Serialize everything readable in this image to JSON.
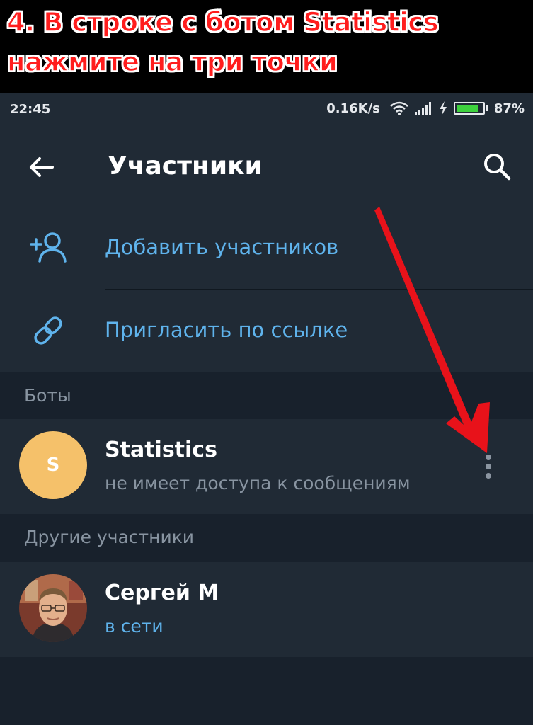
{
  "banner": {
    "line1": "4. В строке с ботом Statistics",
    "line2": "нажмите на три точки",
    "text_color": "#ff1d1d",
    "stroke_color": "#ffffff"
  },
  "status_bar": {
    "time": "22:45",
    "network_speed": "0.16K/s",
    "battery_percent": "87%",
    "battery_level": 0.87,
    "icons": [
      "wifi-icon",
      "signal-icon",
      "charging-icon",
      "battery-icon"
    ]
  },
  "header": {
    "title": "Участники",
    "back_icon": "arrow-left-icon",
    "search_icon": "search-icon"
  },
  "actions": [
    {
      "label": "Добавить участников",
      "icon": "add-user-icon"
    },
    {
      "label": "Пригласить по ссылке",
      "icon": "link-icon"
    }
  ],
  "sections": {
    "bots": {
      "title": "Боты",
      "members": [
        {
          "name": "Statistics",
          "subtitle": "не имеет доступа к сообщениям",
          "avatar_letter": "S",
          "avatar_color": "#f5c16a",
          "menu_icon": "more-vertical-icon"
        }
      ]
    },
    "others": {
      "title": "Другие участники",
      "members": [
        {
          "name": "Сергей М",
          "subtitle": "в сети",
          "avatar": "photo"
        }
      ]
    }
  },
  "colors": {
    "accent": "#5fb3ec",
    "panel": "#202a35",
    "background": "#18212c",
    "secondary_text": "#8894a1",
    "annotation_arrow": "#e8121a"
  }
}
